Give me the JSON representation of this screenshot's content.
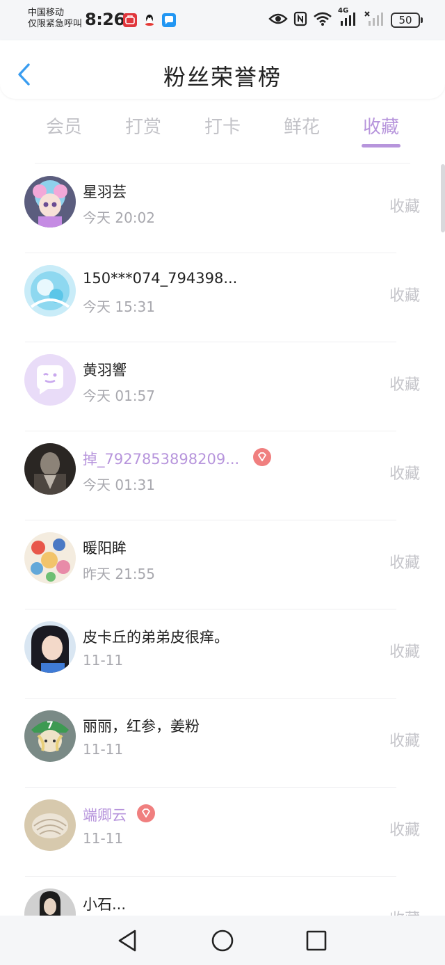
{
  "status_bar": {
    "carrier_line1": "中国移动",
    "carrier_line2": "仅限紧急呼叫",
    "time": "8:26",
    "network_label": "4G",
    "battery": "50",
    "icons": [
      "huawei-app-icon",
      "qq-icon",
      "message-app-icon",
      "eye-icon",
      "nfc-icon",
      "wifi-icon",
      "signal-icon",
      "no-signal-icon",
      "battery-icon"
    ]
  },
  "header": {
    "title": "粉丝荣誉榜",
    "back_icon": "chevron-left-icon"
  },
  "tabs": [
    {
      "label": "会员",
      "active": false
    },
    {
      "label": "打赏",
      "active": false
    },
    {
      "label": "打卡",
      "active": false
    },
    {
      "label": "鲜花",
      "active": false
    },
    {
      "label": "收藏",
      "active": true
    }
  ],
  "fans": [
    {
      "name": "星羽芸",
      "time": "今天 20:02",
      "action": "收藏",
      "vip": false
    },
    {
      "name": "150***074_794398...",
      "time": "今天 15:31",
      "action": "收藏",
      "vip": false
    },
    {
      "name": "黄羽響",
      "time": "今天 01:57",
      "action": "收藏",
      "vip": false
    },
    {
      "name": "掉_7927853898209...",
      "time": "今天 01:31",
      "action": "收藏",
      "vip": true
    },
    {
      "name": "暖阳眸",
      "time": "昨天 21:55",
      "action": "收藏",
      "vip": false
    },
    {
      "name": "皮卡丘的弟弟皮很痒。",
      "time": "11-11",
      "action": "收藏",
      "vip": false
    },
    {
      "name": "丽丽，红参，姜粉",
      "time": "11-11",
      "action": "收藏",
      "vip": false
    },
    {
      "name": "端卿云",
      "time": "11-11",
      "action": "收藏",
      "vip": true
    },
    {
      "name": "小石...",
      "time": "",
      "action": "收藏",
      "vip": false
    }
  ],
  "colors": {
    "accent": "#b795dc",
    "vip_badge": "#f07f7f",
    "muted": "#c6c6cb",
    "back_arrow": "#3a9df0"
  },
  "navbar": {
    "icons": [
      "back-triangle-icon",
      "home-circle-icon",
      "recents-square-icon"
    ]
  }
}
